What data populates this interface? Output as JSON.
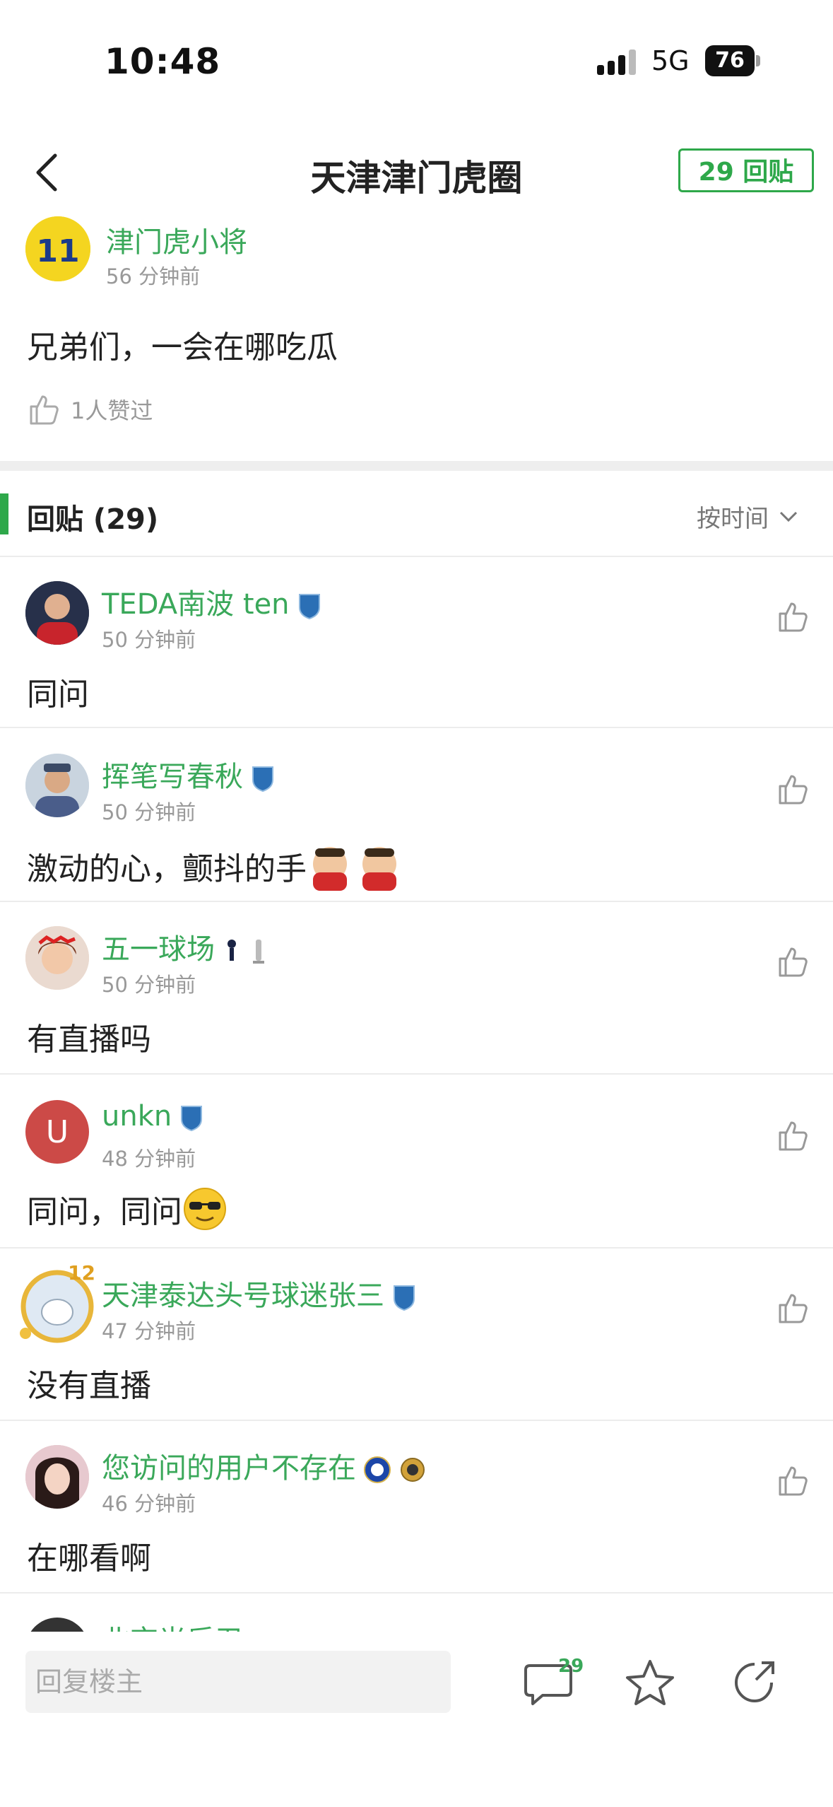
{
  "status_bar": {
    "time": "10:48",
    "network": "5G",
    "battery": "76"
  },
  "nav": {
    "title": "天津津门虎圈",
    "reply_button": "29 回贴"
  },
  "post": {
    "author": "津门虎小将",
    "time": "56 分钟前",
    "text": "兄弟们，一会在哪吃瓜",
    "likes": "1人赞过"
  },
  "replies_header": {
    "title": "回贴 (29)",
    "sort": "按时间"
  },
  "replies": [
    {
      "author": "TEDA南波 ten",
      "time": "50 分钟前",
      "text": "同问"
    },
    {
      "author": "挥笔写春秋",
      "time": "50 分钟前",
      "text": "激动的心，颤抖的手"
    },
    {
      "author": "五一球场",
      "time": "50 分钟前",
      "text": "有直播吗"
    },
    {
      "author": "unkn",
      "time": "48 分钟前",
      "text": "同问，同问",
      "avatar_letter": "U"
    },
    {
      "author": "天津泰达头号球迷张三",
      "time": "47 分钟前",
      "text": "没有直播",
      "avatar_level": "12"
    },
    {
      "author": "您访问的用户不存在",
      "time": "46 分钟前",
      "text": "在哪看啊"
    },
    {
      "author": "北京光后卫",
      "time": "",
      "text": ""
    }
  ],
  "bottom_bar": {
    "input_placeholder": "回复楼主",
    "comment_count": "29"
  },
  "colors": {
    "accent": "#2ea84a",
    "username": "#3aa85a"
  }
}
